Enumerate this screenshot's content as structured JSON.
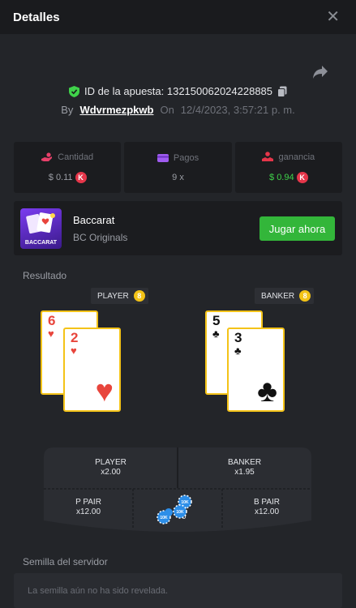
{
  "header": {
    "title": "Detalles",
    "close_glyph": "✕"
  },
  "bet": {
    "id_text": "ID de la apuesta: 132150062024228885",
    "by_label": "By",
    "user": "Wdvrmezpkwb",
    "on_label": "On",
    "date": "12/4/2023, 3:57:21 p. m."
  },
  "stats": {
    "amount": {
      "label": "Cantidad",
      "value": "$ 0.11",
      "icon": "money-hand-icon"
    },
    "payout": {
      "label": "Pagos",
      "value": "9 x",
      "icon": "wallet-icon"
    },
    "profit": {
      "label": "ganancia",
      "value": "$ 0.94",
      "icon": "profit-icon"
    },
    "coin_glyph": "K"
  },
  "game": {
    "name": "Baccarat",
    "provider": "BC Originals",
    "play_label": "Jugar ahora",
    "thumb_label": "BACCARAT"
  },
  "result": {
    "label": "Resultado",
    "player": {
      "label": "PLAYER",
      "score": "8",
      "cards": [
        {
          "rank": "6",
          "suit": "♥"
        },
        {
          "rank": "2",
          "suit": "♥"
        }
      ]
    },
    "banker": {
      "label": "BANKER",
      "score": "8",
      "cards": [
        {
          "rank": "5",
          "suit": "♣"
        },
        {
          "rank": "3",
          "suit": "♣"
        }
      ]
    }
  },
  "bets_table": {
    "player": {
      "name": "PLAYER",
      "odds": "x2.00"
    },
    "banker": {
      "name": "BANKER",
      "odds": "x1.95"
    },
    "p_pair": {
      "name": "P PAIR",
      "odds": "x12.00"
    },
    "tie_partial": "0",
    "b_pair": {
      "name": "B PAIR",
      "odds": "x12.00"
    },
    "chip_label": "10K"
  },
  "seed": {
    "label": "Semilla del servidor",
    "placeholder": "La semilla aún no ha sido revelada."
  },
  "colors": {
    "accent_green": "#33b63a",
    "coin_red": "#e5364a",
    "score_yellow": "#f3c316",
    "card_border": "#f4c318"
  }
}
